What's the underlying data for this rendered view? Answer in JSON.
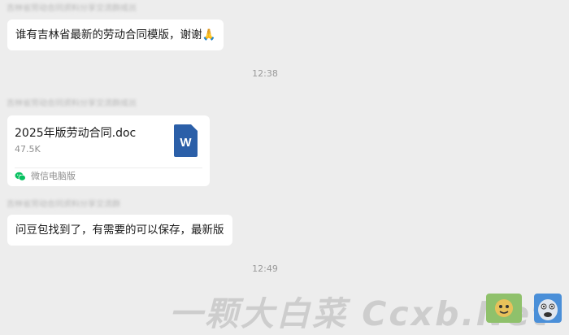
{
  "messages": [
    {
      "sender": "吉林省劳动合同资料分享交流群成员",
      "text": "谁有吉林省最新的劳动合同模版，谢谢🙏"
    },
    {
      "time": "12:38"
    },
    {
      "sender": "吉林省劳动合同资料分享交流群成员",
      "file": {
        "name": "2025年版劳动合同.doc",
        "size": "47.5K",
        "type_letter": "W",
        "source": "微信电脑版"
      }
    },
    {
      "sender": "吉林省劳动合同资料分享交流群",
      "text": "问豆包找到了，有需要的可以保存，最新版"
    },
    {
      "time": "12:49"
    }
  ],
  "watermark": "一颗大白菜  Ccxb.Net",
  "colors": {
    "background": "#ededed",
    "bubble": "#ffffff",
    "word_blue": "#2b5fa8",
    "wechat_green": "#07c160"
  }
}
